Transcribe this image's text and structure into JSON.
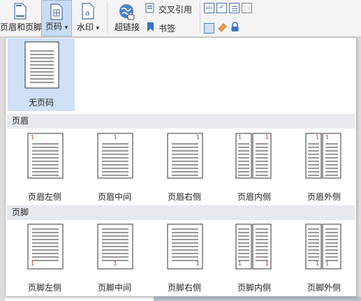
{
  "ribbon": {
    "header_footer_label": "页眉和页脚",
    "page_number_label": "页码",
    "page_number_arrow": "▾",
    "watermark_label": "水印",
    "watermark_arrow": "▾",
    "hyperlink_label": "超链接",
    "cross_ref_label": "交叉引用",
    "bookmark_label": "书签"
  },
  "dropdown": {
    "no_number": {
      "label": "无页码"
    },
    "header_section": {
      "title": "页眉",
      "items": [
        {
          "label": "页眉左侧",
          "number": "1"
        },
        {
          "label": "页眉中间",
          "number": "1"
        },
        {
          "label": "页眉右侧",
          "number": "1"
        },
        {
          "label": "页眉内侧",
          "number": "1"
        },
        {
          "label": "页眉外侧",
          "number": "1"
        }
      ]
    },
    "footer_section": {
      "title": "页脚",
      "items": [
        {
          "label": "页脚左侧",
          "number": "1"
        },
        {
          "label": "页脚中间",
          "number": "1"
        },
        {
          "label": "页脚右侧",
          "number": "1"
        },
        {
          "label": "页脚内侧",
          "number": "1"
        },
        {
          "label": "页脚外侧",
          "number": "1"
        }
      ]
    }
  },
  "colors": {
    "selected_bg": "#cfe0f7",
    "number_red": "#c0392b",
    "section_bg": "#e6e9ee"
  }
}
